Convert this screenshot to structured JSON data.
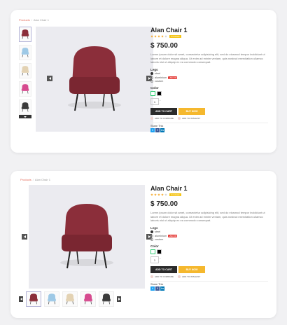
{
  "breadcrumb": {
    "link": "Products",
    "current": "Alan Chair 1"
  },
  "product": {
    "title": "Alan Chair 1",
    "rating": 4,
    "rating_max": 5,
    "reviews_label": "4 reviews",
    "price": "$ 750.00",
    "description": "Lorem ipsum dolor sit amet, consectetur adipisicing elit, sed do eiusmod tempor incididunt ut labore et dolore magna aliqua. Ut enim ad minim veniam, quis nostrud exercitation ullamco laboris nisi ut aliquip ex ea commodo consequat."
  },
  "legs": {
    "label": "Legs",
    "options": [
      {
        "label": "steel",
        "selected": true,
        "badge": ""
      },
      {
        "label": "aluminium",
        "selected": false,
        "badge": "+$10.00"
      },
      {
        "label": "custom",
        "selected": false,
        "badge": ""
      }
    ]
  },
  "color": {
    "label": "Color",
    "swatches": [
      "#ffffff",
      "#000000"
    ]
  },
  "quantity": {
    "value": "1",
    "up": "+",
    "down": "-"
  },
  "actions": {
    "add_to_cart": "ADD TO CART",
    "buy_now": "BUY NOW",
    "compare": "ADD TO COMPARE",
    "wishlist": "ADD TO WISHLIST"
  },
  "share": {
    "label": "Share This",
    "networks": [
      {
        "name": "twitter-icon",
        "glyph": "t",
        "color": "#1da1f2"
      },
      {
        "name": "facebook-icon",
        "glyph": "f",
        "color": "#3b5998"
      },
      {
        "name": "linkedin-icon",
        "glyph": "in",
        "color": "#0077b5"
      }
    ]
  },
  "thumbnail_colors": [
    "#8b2e3a",
    "#9ec9e6",
    "#e3d2b3",
    "#d64b8f",
    "#3a3a3a"
  ],
  "accent": "#e36b5a"
}
